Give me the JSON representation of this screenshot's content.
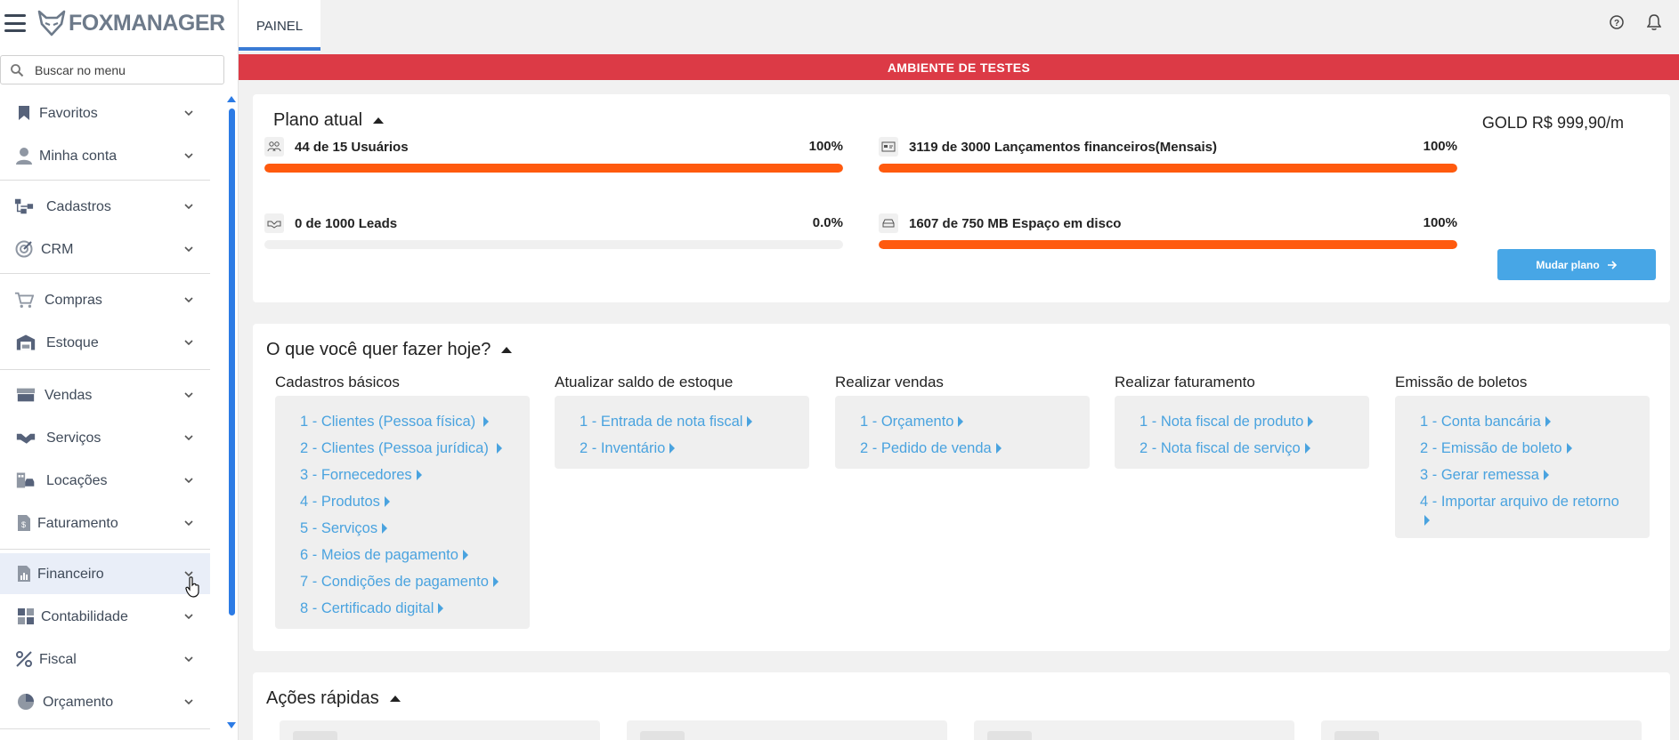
{
  "brand": {
    "name": "FOXMANAGER"
  },
  "search": {
    "placeholder": "Buscar no menu"
  },
  "sidebar": {
    "items": [
      {
        "label": "Favoritos",
        "icon": "bookmark-icon"
      },
      {
        "label": "Minha conta",
        "icon": "user-icon"
      },
      {
        "label": "Cadastros",
        "icon": "sitemap-icon"
      },
      {
        "label": "CRM",
        "icon": "target-icon"
      },
      {
        "label": "Compras",
        "icon": "cart-icon"
      },
      {
        "label": "Estoque",
        "icon": "warehouse-icon"
      },
      {
        "label": "Vendas",
        "icon": "store-icon"
      },
      {
        "label": "Serviços",
        "icon": "handshake-icon"
      },
      {
        "label": "Locações",
        "icon": "building-car-icon"
      },
      {
        "label": "Faturamento",
        "icon": "invoice-icon"
      },
      {
        "label": "Financeiro",
        "icon": "chart-file-icon"
      },
      {
        "label": "Contabilidade",
        "icon": "calculator-icon"
      },
      {
        "label": "Fiscal",
        "icon": "percent-icon"
      },
      {
        "label": "Orçamento",
        "icon": "pie-chart-icon"
      }
    ]
  },
  "topbar": {
    "tab_label": "PAINEL"
  },
  "banner": {
    "text": "AMBIENTE DE TESTES"
  },
  "plan": {
    "title": "Plano atual",
    "price": "GOLD R$ 999,90/m",
    "usage": [
      {
        "label": "44 de 15 Usuários",
        "pct": "100%",
        "value": 1.0,
        "icon": "users-icon"
      },
      {
        "label": "3119 de 3000 Lançamentos financeiros(Mensais)",
        "pct": "100%",
        "value": 1.0,
        "icon": "card-icon"
      },
      {
        "label": "0 de 1000 Leads",
        "pct": "0.0%",
        "value": 0.0,
        "icon": "leads-icon"
      },
      {
        "label": "1607 de 750 MB Espaço em disco",
        "pct": "100%",
        "value": 1.0,
        "icon": "disk-icon"
      }
    ],
    "button_label": "Mudar plano",
    "bar_color": "#ff5a0e"
  },
  "today": {
    "title": "O que você quer fazer hoje?",
    "columns": [
      {
        "title": "Cadastros básicos",
        "links": [
          "1 - Clientes (Pessoa física)",
          "2 - Clientes (Pessoa jurídica)",
          "3 - Fornecedores",
          "4 - Produtos",
          "5 - Serviços",
          "6 - Meios de pagamento",
          "7 - Condições de pagamento",
          "8 - Certificado digital"
        ]
      },
      {
        "title": "Atualizar saldo de estoque",
        "links": [
          "1 - Entrada de nota fiscal",
          "2 - Inventário"
        ]
      },
      {
        "title": "Realizar vendas",
        "links": [
          "1 - Orçamento",
          "2 - Pedido de venda"
        ]
      },
      {
        "title": "Realizar faturamento",
        "links": [
          "1 - Nota fiscal de produto",
          "2 - Nota fiscal de serviço"
        ]
      },
      {
        "title": "Emissão de boletos",
        "links": [
          "1 - Conta bancária",
          "2 - Emissão de boleto",
          "3 - Gerar remessa",
          "4 - Importar arquivo de retorno"
        ]
      }
    ]
  },
  "quick": {
    "title": "Ações rápidas"
  },
  "colors": {
    "banner": "#dc3a46",
    "accent": "#3a7bd5",
    "link": "#4aa3df",
    "button": "#47a6e6"
  }
}
